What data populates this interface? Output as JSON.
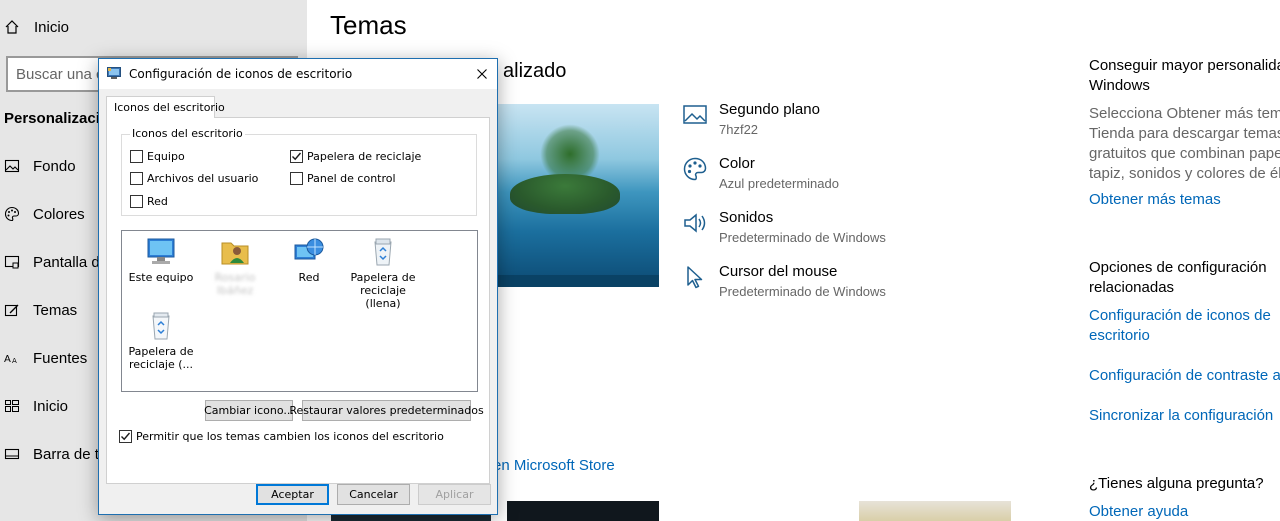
{
  "nav": {
    "home": "Inicio",
    "search_placeholder": "Buscar una c",
    "section": "Personalizació",
    "items": [
      {
        "label": "Fondo",
        "icon": "image-icon"
      },
      {
        "label": "Colores",
        "icon": "palette-icon"
      },
      {
        "label": "Pantalla d",
        "icon": "lock-screen-icon"
      },
      {
        "label": "Temas",
        "icon": "themes-icon"
      },
      {
        "label": "Fuentes",
        "icon": "fonts-icon"
      },
      {
        "label": "Inicio",
        "icon": "start-icon"
      },
      {
        "label": "Barra de t",
        "icon": "taskbar-icon"
      }
    ]
  },
  "main": {
    "title": "Temas",
    "section_title": "alizado",
    "properties": [
      {
        "title": "Segundo plano",
        "value": "7hzf22",
        "icon": "background-icon"
      },
      {
        "title": "Color",
        "value": "Azul predeterminado",
        "icon": "palette-icon"
      },
      {
        "title": "Sonidos",
        "value": "Predeterminado de Windows",
        "icon": "speaker-icon"
      },
      {
        "title": "Cursor del mouse",
        "value": "Predeterminado de Windows",
        "icon": "cursor-icon"
      }
    ],
    "store_link": "en Microsoft Store"
  },
  "right": {
    "get_more_title": [
      "Conseguir mayor personalida",
      "Windows"
    ],
    "get_more_text": [
      "Selecciona Obtener más tema",
      "Tienda para descargar temas",
      "gratuitos que combinan pape",
      "tapiz, sonidos y colores de él"
    ],
    "get_more_link": "Obtener más temas",
    "related_title": [
      "Opciones de configuración",
      "relacionadas"
    ],
    "related_links": [
      "Configuración de iconos de",
      "escritorio",
      "Configuración de contraste a",
      "Sincronizar la configuración"
    ],
    "question_title": "¿Tienes alguna pregunta?",
    "help_link": "Obtener ayuda"
  },
  "dialog": {
    "title": "Configuración de iconos de escritorio",
    "tab": "Iconos del escritorio",
    "group_label": "Iconos del escritorio",
    "checkboxes": [
      {
        "label": "Equipo",
        "checked": false
      },
      {
        "label": "Papelera de reciclaje",
        "checked": true
      },
      {
        "label": "Archivos del usuario",
        "checked": false
      },
      {
        "label": "Panel de control",
        "checked": false
      },
      {
        "label": "Red",
        "checked": false
      }
    ],
    "icons": [
      {
        "label": "Este equipo",
        "icon": "computer-icon"
      },
      {
        "label": "Rosario\nIbáñez",
        "icon": "user-folder-icon"
      },
      {
        "label": "Red",
        "icon": "network-icon"
      },
      {
        "label": "Papelera de\nreciclaje (llena)",
        "icon": "recycle-bin-full-icon"
      },
      {
        "label": "Papelera de\nreciclaje (...",
        "icon": "recycle-bin-empty-icon"
      }
    ],
    "change_icon": "Cambiar icono...",
    "restore_defaults": "Restaurar valores predeterminados",
    "allow_themes": "Permitir que los temas cambien los iconos del escritorio",
    "allow_themes_checked": true,
    "ok": "Aceptar",
    "cancel": "Cancelar",
    "apply": "Aplicar"
  }
}
